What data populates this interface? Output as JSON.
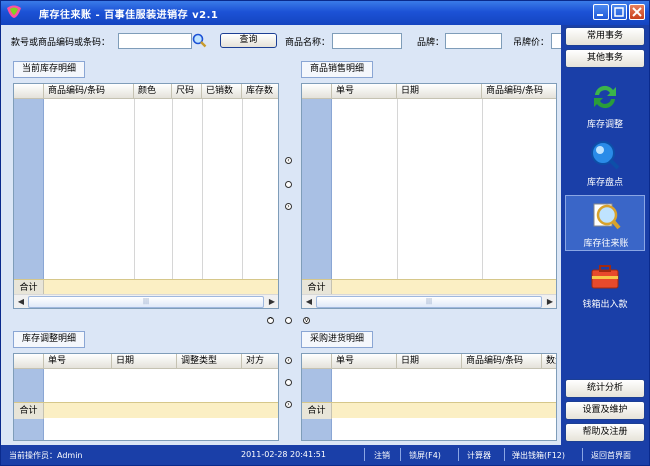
{
  "window": {
    "title": "库存往来账 - 百事佳服装进销存 v2.1"
  },
  "filters": {
    "code_label": "款号或商品编码或条码：",
    "query_button": "查询",
    "name_label": "商品名称：",
    "brand_label": "品牌：",
    "price_label": "吊牌价：",
    "code_value": "",
    "name_value": "",
    "brand_value": "",
    "price_value": ""
  },
  "panels": {
    "stock": {
      "title": "当前库存明细",
      "columns": [
        "商品编码/条码",
        "颜色",
        "尺码",
        "已销数",
        "库存数"
      ],
      "sum_label": "合计"
    },
    "sales": {
      "title": "商品销售明细",
      "columns": [
        "单号",
        "日期",
        "商品编码/条码"
      ],
      "sum_label": "合计"
    },
    "adjust": {
      "title": "库存调整明细",
      "columns": [
        "单号",
        "日期",
        "调整类型",
        "对方"
      ],
      "sum_label": "合计"
    },
    "purchase": {
      "title": "采购进货明细",
      "columns": [
        "单号",
        "日期",
        "商品编码/条码",
        "数量"
      ],
      "sum_label": "合计"
    }
  },
  "sidebar": {
    "top_buttons": [
      "常用事务",
      "其他事务"
    ],
    "tools": [
      {
        "label": "库存调整",
        "icon": "refresh-arrows-icon"
      },
      {
        "label": "库存盘点",
        "icon": "magnifier-globe-icon"
      },
      {
        "label": "库存往来账",
        "icon": "magnifier-ledger-icon"
      },
      {
        "label": "钱箱出入款",
        "icon": "cash-box-icon"
      }
    ],
    "bottom_buttons": [
      "统计分析",
      "设置及维护",
      "帮助及注册"
    ]
  },
  "status": {
    "operator": "当前操作员：Admin",
    "datetime": "2011-02-28 20:41:51",
    "logout": "注销",
    "lock": "锁屏(F4)",
    "calculator": "计算器",
    "cashbox": "弹出钱箱(F12)",
    "home": "返回首界面"
  },
  "colors": {
    "titlebar": "#1c52d6",
    "sidebar": "#1a3fa8",
    "content": "#dbe6f6",
    "row_header": "#a9c0e4",
    "sum_row": "#fbefc4"
  }
}
